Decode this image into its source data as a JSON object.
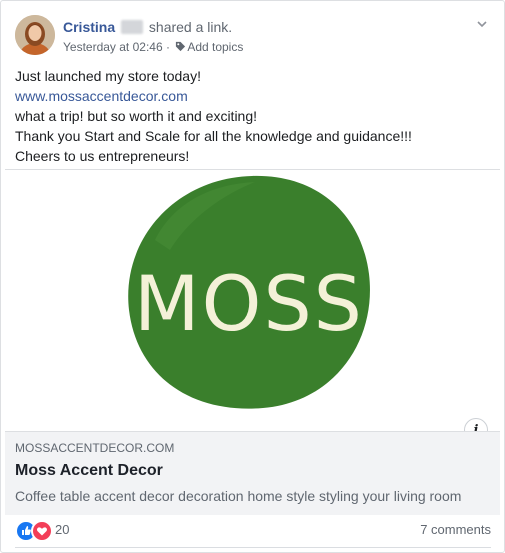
{
  "post": {
    "author_name": "Cristina",
    "author_action": "shared a link.",
    "timestamp": "Yesterday at 02:46",
    "separator": " · ",
    "add_topics": "Add topics",
    "icons": {
      "avatar": "avatar-photo",
      "topics": "tag-icon",
      "options": "chevron-down-icon"
    },
    "body_lines": [
      "Just launched my store today!",
      "www.mossaccentdecor.com",
      "what a trip! but so worth it and exciting!",
      "Thank you Start and Scale for all the knowledge and guidance!!!",
      "Cheers to us entrepreneurs!"
    ]
  },
  "link_card": {
    "logo_text": "MOSS",
    "logo_color": "#3a7f2c",
    "logo_text_color": "#f4f1d8",
    "info_label": "i",
    "domain": "MOSSACCENTDECOR.COM",
    "title": "Moss Accent Decor",
    "description": "Coffee table accent decor decoration home style styling your living room"
  },
  "reactions": {
    "count": "20",
    "comments": "7 comments",
    "types": [
      "like",
      "love"
    ],
    "colors": {
      "like": "#1877f2",
      "love": "#f33e58",
      "link": "#385898"
    }
  }
}
